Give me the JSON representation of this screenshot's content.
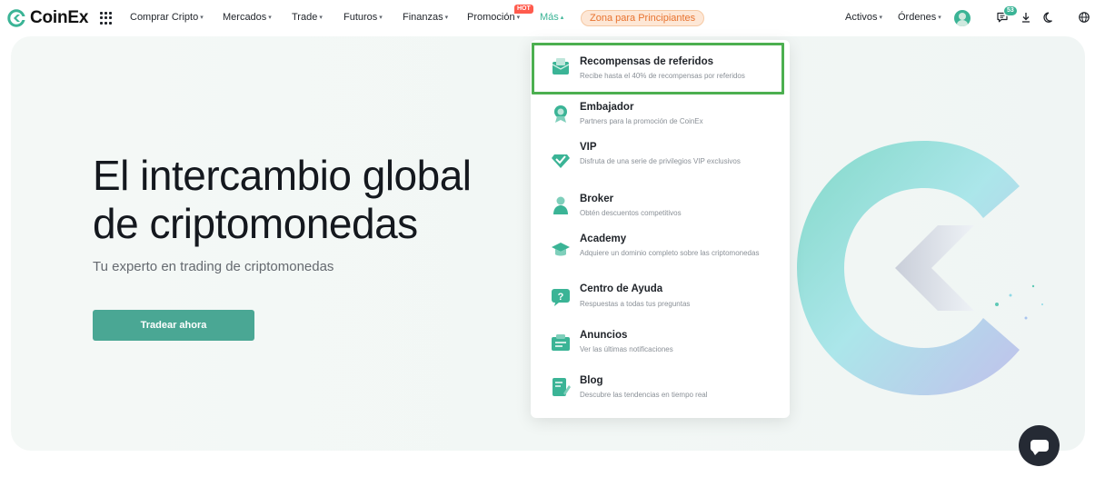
{
  "brand": {
    "name": "CoinEx",
    "accent": "#3bb496",
    "cta_color": "#4aa794",
    "highlight_color": "#4caf50"
  },
  "nav": {
    "items": [
      {
        "label": "Comprar Cripto",
        "caret": "▾"
      },
      {
        "label": "Mercados",
        "caret": "▾"
      },
      {
        "label": "Trade",
        "caret": "▾"
      },
      {
        "label": "Futuros",
        "caret": "▾"
      },
      {
        "label": "Finanzas",
        "caret": "▾"
      },
      {
        "label": "Promoción",
        "caret": "▾"
      },
      {
        "label": "Más",
        "caret": "▴"
      }
    ],
    "hot_badge": "HOT",
    "beginner_zone": "Zona para Principiantes",
    "right": {
      "assets": "Activos",
      "orders": "Órdenes",
      "messages_count": "53"
    }
  },
  "hero": {
    "title_line1": "El intercambio global",
    "title_line2": "de criptomonedas",
    "subtitle": "Tu experto en trading de criptomonedas",
    "cta": "Tradear ahora"
  },
  "dropdown": {
    "items": [
      {
        "title": "Recompensas de referidos",
        "desc": "Recibe hasta el 40% de recompensas por referidos",
        "icon": "gift-envelope-icon"
      },
      {
        "title": "Embajador",
        "desc": "Partners para la promoción de CoinEx",
        "icon": "medal-icon"
      },
      {
        "title": "VIP",
        "desc": "Disfruta de una serie de privilegios VIP exclusivos",
        "icon": "diamond-icon"
      },
      {
        "title": "Broker",
        "desc": "Obtén descuentos competitivos",
        "icon": "person-icon"
      },
      {
        "title": "Academy",
        "desc": "Adquiere un dominio completo sobre las criptomonedas",
        "icon": "graduation-cap-icon"
      },
      {
        "title": "Centro de Ayuda",
        "desc": "Respuestas a todas tus preguntas",
        "icon": "help-icon"
      },
      {
        "title": "Anuncios",
        "desc": "Ver las últimas notificaciones",
        "icon": "announcement-icon"
      },
      {
        "title": "Blog",
        "desc": "Descubre las tendencias en tiempo real",
        "icon": "blog-icon"
      }
    ]
  }
}
